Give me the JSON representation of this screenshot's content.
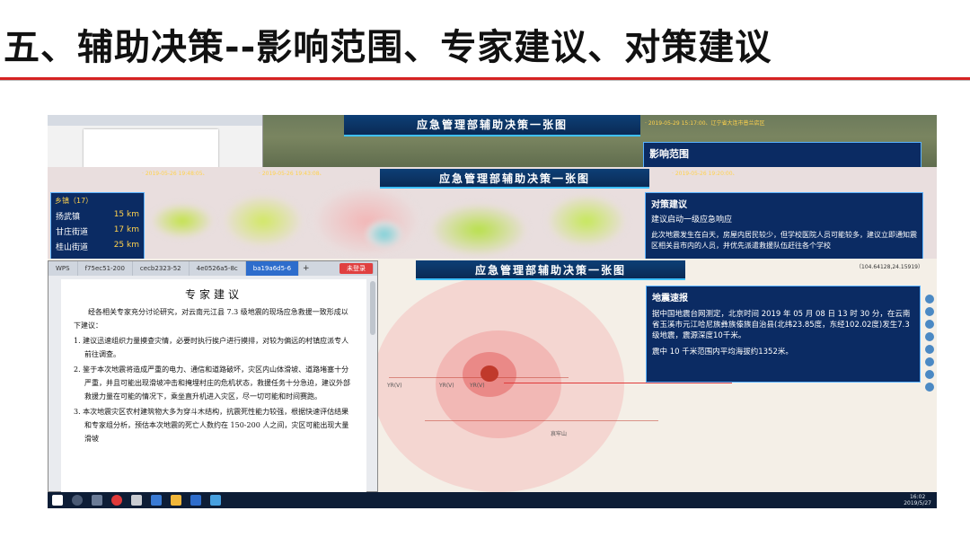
{
  "slide": {
    "title": "五、辅助决策--影响范围、专家建议、对策建议"
  },
  "layer1": {
    "header": "应急管理部辅助决策一张图",
    "ticker": "· 2019-05-29 15:17:00、辽宁省大连市普兰店区",
    "panel_title": "影响范围"
  },
  "layer2": {
    "header": "应急管理部辅助决策一张图",
    "ticker_left": "· 2019-05-26 19:48:05、",
    "ticker_mid": "· 2019-05-26 19:43:08、",
    "ticker_right": "· 2019-05-26 19:20:00、",
    "list_caption": "乡镇（17）",
    "list": [
      {
        "name": "扬武镇",
        "km": "15 km"
      },
      {
        "name": "甘庄街道",
        "km": "17 km"
      },
      {
        "name": "桂山街道",
        "km": "25 km"
      }
    ],
    "panel_title": "对策建议",
    "panel_subtitle": "建议启动一级应急响应",
    "panel_text": "此次地震发生在白天，房屋内居民较少，但学校医院人员可能较多，建议立即通知震区相关县市内的人员，并优先派遣救援队伍赶往各个学校"
  },
  "layer3": {
    "header": "应急管理部辅助决策一张图",
    "coords": "（104.64128,24.15919）",
    "panel_title": "地震速报",
    "panel_text": "据中国地震台网测定，北京时间 2019 年 05 月 08 日 13 时 30 分，在云南省玉溪市元江哈尼族彝族傣族自治县(北纬23.85度，东经102.02度)发生7.3级地震，震源深度10千米。",
    "panel_text2": "震中 10 千米范围内平均海拔约1352米。",
    "map_labels": [
      "YR(V)",
      "YR(V)",
      "YR(V)",
      "哀牢山"
    ]
  },
  "document": {
    "tabs": [
      {
        "label": "WPS"
      },
      {
        "label": "f75ec51-200"
      },
      {
        "label": "cecb2323-52"
      },
      {
        "label": "4e0526a5-8c"
      },
      {
        "label": "ba19a6d5-6"
      }
    ],
    "new_tab": "+",
    "badge": "未登录",
    "heading": "专家建议",
    "intro": "经各相关专家充分讨论研究，对云南元江县 7.3 级地震的现场应急救援一致形成以下建议：",
    "items": [
      "1. 建议迅速组织力量摸查灾情，必要时执行挨户进行摸排，对较为偏远的村镇应派专人前往调查。",
      "2. 鉴于本次地震将造成严重的电力、通信和道路破坏，灾区内山体滑坡、道路堵塞十分严重，并且可能出现滑坡冲击和掩埋村庄的危机状态，救援任务十分急迫，建议外部救援力量在可能的情况下，乘坐直升机进入灾区，尽一切可能和时间赛跑。",
      "3. 本次地震灾区农村建筑物大多为穿斗木结构，抗震死性能力较强，根据快速评估结果和专家组分析，预估本次地震的死亡人数约在 150-200 人之间，灾区可能出现大量滑坡"
    ]
  },
  "taskbar": {
    "time": "16:02",
    "date": "2019/5/27"
  },
  "colors": {
    "accent_red": "#d62222",
    "panel_blue": "#0b2b63",
    "panel_border": "#5ab3ff",
    "highlight_yellow": "#ffd24d"
  }
}
